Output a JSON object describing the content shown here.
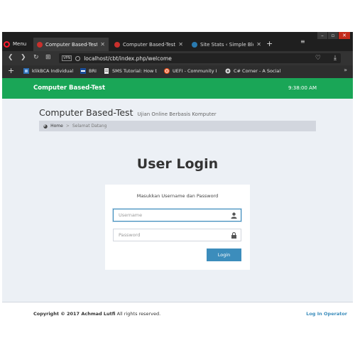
{
  "browser": {
    "menu_label": "Menu",
    "tabs": [
      {
        "title": "Computer Based-Test | Se",
        "active": true
      },
      {
        "title": "Computer Based-Test | He",
        "active": false
      },
      {
        "title": "Site Stats ‹ Simple Blogs...",
        "active": false
      }
    ],
    "new_tab": "+",
    "url": "localhost/cbt/index.php/welcome",
    "vpn_label": "VPN",
    "bookmarks": [
      {
        "label": "klikBCA Individual"
      },
      {
        "label": "BRI"
      },
      {
        "label": "SMS Tutorial: How t"
      },
      {
        "label": "UEFI - Community I"
      },
      {
        "label": "C# Corner - A Social"
      }
    ]
  },
  "page": {
    "navbar": {
      "brand": "Computer Based-Test",
      "time": "9:38:00 AM"
    },
    "header": {
      "title": "Computer Based-Test",
      "subtitle": "Ujian Online Berbasis Komputer"
    },
    "breadcrumb": {
      "home": "Home",
      "separator": ">",
      "current": "Selamat Datang"
    },
    "login": {
      "title": "User Login",
      "message": "Masukkan Username dan Password",
      "username_placeholder": "Username",
      "username_value": "",
      "password_placeholder": "Password",
      "password_value": "",
      "button_label": "Login"
    },
    "footer": {
      "copyright_bold": "Copyright © 2017 Achmad Lutfi",
      "copyright_rest": " All rights reserved.",
      "operator_link": "Log In Operator"
    }
  },
  "colors": {
    "navbar": "#1aa657",
    "accent": "#3c8dbc",
    "page_bg": "#ecf0f5"
  }
}
